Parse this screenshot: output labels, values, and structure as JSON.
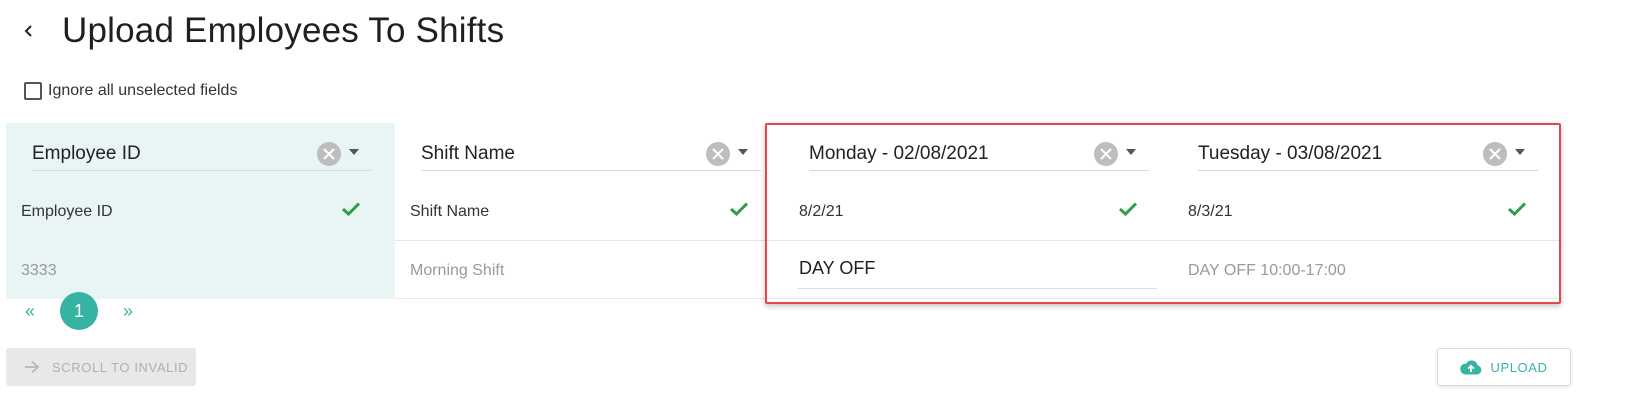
{
  "header": {
    "title": "Upload Employees To Shifts",
    "back_icon": "chevron-left-icon"
  },
  "options": {
    "ignore_label": "Ignore all unselected fields",
    "ignore_checked": false
  },
  "columns": [
    {
      "mapping": "Employee ID",
      "header_value": "Employee ID",
      "row_value": "3333"
    },
    {
      "mapping": "Shift Name",
      "header_value": "Shift Name",
      "row_value": "Morning Shift"
    },
    {
      "mapping": "Monday - 02/08/2021",
      "header_value": "8/2/21",
      "row_value": "DAY OFF"
    },
    {
      "mapping": "Tuesday - 03/08/2021",
      "header_value": "8/3/21",
      "row_value": "DAY OFF 10:00-17:00"
    }
  ],
  "pagination": {
    "prev": "«",
    "current": "1",
    "next": "»"
  },
  "actions": {
    "scroll_label": "SCROLL TO INVALID",
    "upload_label": "UPLOAD"
  },
  "colors": {
    "accent": "#37b3a4",
    "valid": "#2e9e4a",
    "highlight": "#e2474f",
    "first_col_bg": "#e8f5f4"
  }
}
